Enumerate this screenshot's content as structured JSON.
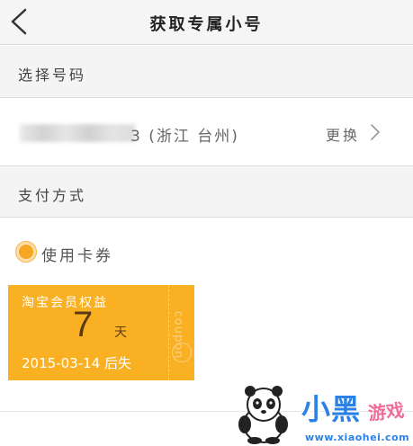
{
  "header": {
    "title": "获取专属小号"
  },
  "section_number": {
    "label": "选择号码"
  },
  "number_row": {
    "number_suffix": "3 (浙江 台州)",
    "change_label": "更换"
  },
  "section_payment": {
    "label": "支付方式"
  },
  "payment_option": {
    "label": "使用卡券",
    "selected": true
  },
  "coupon": {
    "title": "淘宝会员权益",
    "days": "7",
    "unit": "天",
    "expiry": "2015-03-14 后失",
    "vertical_text": "coupon",
    "color": "#f9b123"
  },
  "watermark": {
    "brand": "小黑",
    "brand_sub": "游戏",
    "site": "www.xiaohei.com"
  },
  "colors": {
    "accent": "#f5a623",
    "section_bg": "#f4f4f4",
    "divider": "#dcdcdc"
  },
  "icons": {
    "back": "back-arrow-icon",
    "chevron": "chevron-right-icon",
    "radio": "radio-selected-icon"
  }
}
